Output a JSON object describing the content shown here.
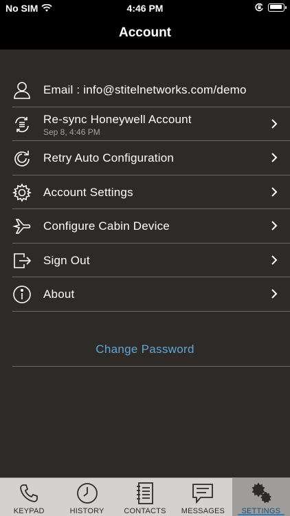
{
  "status": {
    "carrier": "No SIM",
    "time": "4:46 PM"
  },
  "header": {
    "title": "Account"
  },
  "menu": {
    "email": {
      "label": "Email : info@stitelnetworks.com/demo",
      "icon": "user-icon"
    },
    "resync": {
      "label": "Re-sync Honeywell Account",
      "sublabel": "Sep 8, 4:46 PM",
      "icon": "sync-icon"
    },
    "retry": {
      "label": "Retry Auto Configuration",
      "icon": "refresh-icon"
    },
    "settings": {
      "label": "Account Settings",
      "icon": "gear-icon"
    },
    "cabin": {
      "label": "Configure Cabin Device",
      "icon": "airplane-icon"
    },
    "signout": {
      "label": "Sign Out",
      "icon": "sign-out-icon"
    },
    "about": {
      "label": "About",
      "icon": "info-icon"
    }
  },
  "change_password": {
    "label": "Change Password"
  },
  "tabs": {
    "keypad": "KEYPAD",
    "history": "HISTORY",
    "contacts": "CONTACTS",
    "messages": "MESSAGES",
    "settings": "SETTINGS",
    "active": "SETTINGS"
  },
  "colors": {
    "background": "#2d2a27",
    "header": "#000000",
    "link": "#62a6d6",
    "tab_bar": "#d3d2d1",
    "tab_active": "#9e9d9c",
    "tab_underline": "#2f7fc0"
  }
}
